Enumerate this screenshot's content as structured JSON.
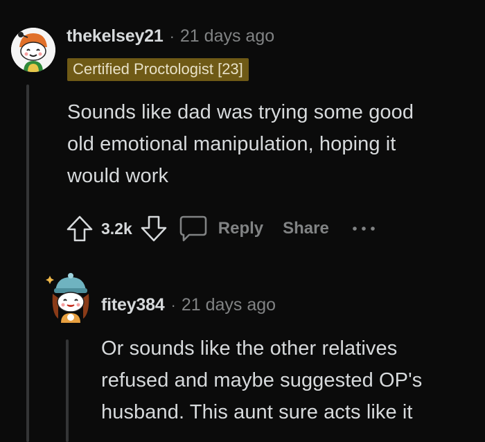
{
  "comment1": {
    "username": "thekelsey21",
    "separator": "·",
    "time": "21 days ago",
    "flair": "Certified Proctologist [23]",
    "body_lines": [
      "Sounds like dad was trying some good",
      "old emotional manipulation, hoping it",
      "would work"
    ],
    "score": "3.2k",
    "reply_label": "Reply",
    "share_label": "Share"
  },
  "comment2": {
    "username": "fitey384",
    "separator": "·",
    "time": "21 days ago",
    "body_lines": [
      "Or sounds like the other relatives",
      "refused and maybe suggested OP's",
      "husband. This aunt sure acts like it"
    ]
  },
  "icons": {
    "upvote": "arrow-up-icon",
    "downvote": "arrow-down-icon",
    "reply": "speech-bubble-icon",
    "more": "ellipsis-icon"
  },
  "colors": {
    "background": "#0b0b0b",
    "text": "#d7dadc",
    "muted": "#818384",
    "flair_bg": "#6f5a16",
    "thread_line": "#343536"
  }
}
